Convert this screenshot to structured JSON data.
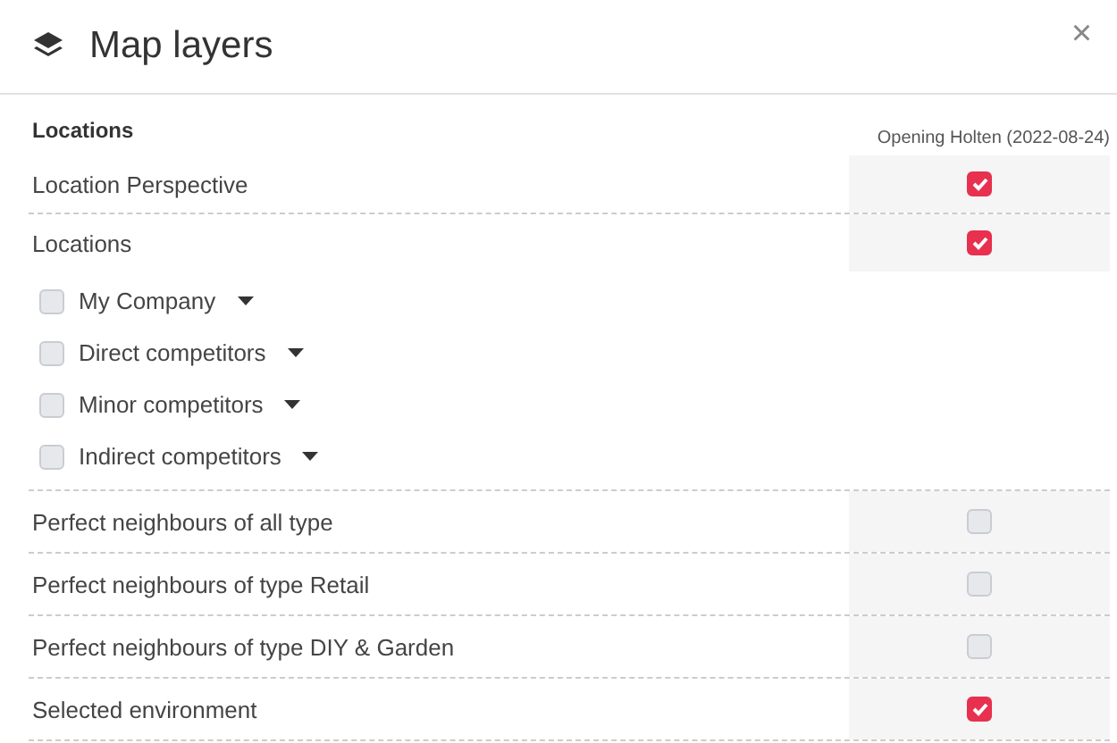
{
  "dialog": {
    "title": "Map layers",
    "close": "×"
  },
  "section": {
    "title": "Locations",
    "column": "Opening Holten (2022-08-24)"
  },
  "rows": [
    {
      "label": "Location Perspective",
      "checked": true
    },
    {
      "label": "Locations",
      "checked": true,
      "children": [
        {
          "label": "My Company",
          "checked": false
        },
        {
          "label": "Direct competitors",
          "checked": false
        },
        {
          "label": "Minor competitors",
          "checked": false
        },
        {
          "label": "Indirect competitors",
          "checked": false
        }
      ]
    },
    {
      "label": "Perfect neighbours of all type",
      "checked": false
    },
    {
      "label": "Perfect neighbours of type Retail",
      "checked": false
    },
    {
      "label": "Perfect neighbours of type DIY & Garden",
      "checked": false
    },
    {
      "label": "Selected environment",
      "checked": true
    }
  ]
}
